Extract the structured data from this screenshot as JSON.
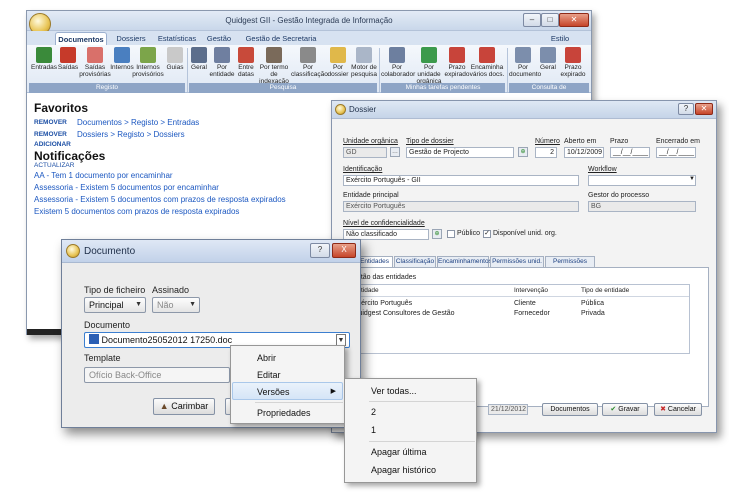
{
  "main_window": {
    "title": "Quidgest GII - Gestão Integrada de Informação",
    "tabs": [
      "Documentos",
      "Dossiers",
      "Estatísticas",
      "Gestão",
      "Gestão de Secretaria"
    ],
    "style_menu": "Estilo",
    "ribbon": {
      "groups": [
        {
          "label": "Registo",
          "buttons": [
            "Entradas",
            "Saídas",
            "Saídas provisórias",
            "Internos",
            "Internos provisórios",
            "Guias"
          ]
        },
        {
          "label": "Pesquisa",
          "buttons": [
            "Geral",
            "Por entidade",
            "Entre datas",
            "Por termo de indexação",
            "Por classificação",
            "Por dossier",
            "Motor de pesquisa"
          ]
        },
        {
          "label": "Minhas tarefas pendentes",
          "buttons": [
            "Por colaborador",
            "Por unidade orgânica",
            "Prazo expirado",
            "Encaminha vários docs."
          ]
        },
        {
          "label": "Consulta de encaminhamentos",
          "buttons": [
            "Por documento",
            "Geral",
            "Prazo expirado"
          ]
        }
      ]
    },
    "favorites": {
      "title": "Favoritos",
      "items": [
        {
          "action": "REMOVER",
          "link": "Documentos > Registo > Entradas"
        },
        {
          "action": "REMOVER",
          "link": "Dossiers > Registo > Dossiers"
        }
      ],
      "add_label": "ADICIONAR"
    },
    "notifications": {
      "title": "Notificações",
      "refresh_label": "ACTUALIZAR",
      "items": [
        "AA - Tem 1 documento por encaminhar",
        "Assessoria - Existem 5 documentos por encaminhar",
        "Assessoria - Existem 5 documentos com prazos de resposta expirados",
        "Existem 5 documentos com prazos de resposta expirados"
      ]
    }
  },
  "dossier_window": {
    "title": "Dossier",
    "fields": {
      "unidade_organica": {
        "label": "Unidade orgânica",
        "value": "GD"
      },
      "tipo_dossier": {
        "label": "Tipo de dossier",
        "value": "Gestão de Projecto"
      },
      "numero": {
        "label": "Número",
        "value": "2"
      },
      "aberto_em": {
        "label": "Aberto em",
        "value": "10/12/2009"
      },
      "prazo": {
        "label": "Prazo",
        "value": "__/__/____"
      },
      "encerrado_em": {
        "label": "Encerrado em",
        "value": "__/__/____"
      },
      "identificacao": {
        "label": "Identificação",
        "value": "Exército Português - GII"
      },
      "workflow": {
        "label": "Workflow",
        "value": ""
      },
      "entidade_principal": {
        "label": "Entidade principal",
        "value": "Exército Português"
      },
      "gestor_processo": {
        "label": "Gestor do processo",
        "value": "BG"
      },
      "nivel_confidencialidade": {
        "label": "Nível de confidencialidade",
        "value": "Não classificado"
      },
      "publico": {
        "label": "Público",
        "checked": false
      },
      "disponivel": {
        "label": "Disponível unid. org.",
        "checked": true
      }
    },
    "tabs": [
      "Entidades",
      "Classificação",
      "Encaminhamentos",
      "Permissões unid. org.",
      "Permissões colab."
    ],
    "entities_section": "Gestão das entidades",
    "table": {
      "columns": [
        "Entidade",
        "Intervenção",
        "Tipo de entidade"
      ],
      "rows": [
        [
          "Exército Português",
          "Cliente",
          "Pública"
        ],
        [
          "Quidgest Consultores de Gestão",
          "Fornecedor",
          "Privada"
        ]
      ]
    },
    "footer_date": "21/12/2012",
    "buttons": {
      "documentos": "Documentos",
      "gravar": "Gravar",
      "cancelar": "Cancelar"
    }
  },
  "documento_dialog": {
    "title": "Documento",
    "tipo_ficheiro": {
      "label": "Tipo de ficheiro",
      "value": "Principal"
    },
    "assinado": {
      "label": "Assinado",
      "value": "Não"
    },
    "documento": {
      "label": "Documento",
      "value": "Documento25052012 17250.doc"
    },
    "template": {
      "label": "Template",
      "value": "Ofício Back-Office"
    },
    "carimbar_button": "Carimbar",
    "help": "?",
    "close": "X"
  },
  "context_menu": {
    "items": [
      "Abrir",
      "Editar",
      "Versões",
      "Propriedades"
    ],
    "highlighted": "Versões"
  },
  "submenu": {
    "items": [
      "Ver todas...",
      "2",
      "1",
      "Apagar última",
      "Apagar histórico"
    ]
  },
  "colors": {
    "link_blue": "#1c58c1",
    "ribbon_group": "#8ea5c6",
    "title_bar": "#c9d7ea"
  }
}
